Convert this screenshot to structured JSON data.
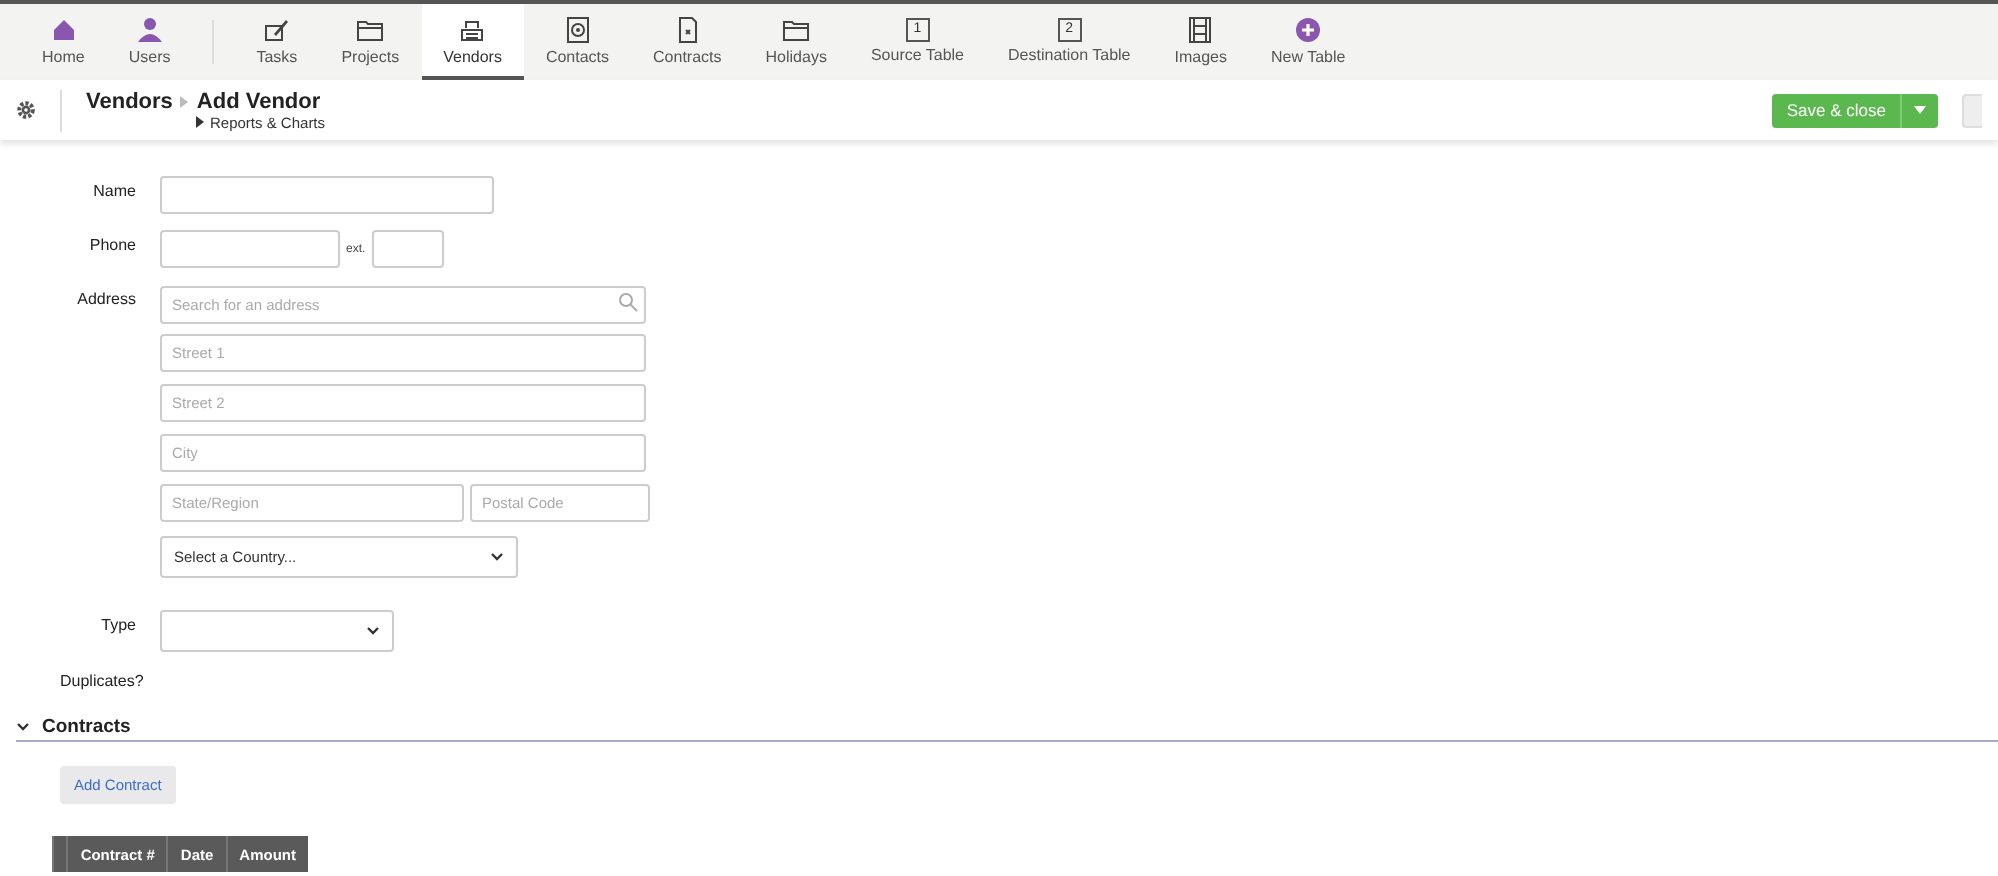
{
  "nav": {
    "items": [
      {
        "label": "Home",
        "kind": "home",
        "selected": false
      },
      {
        "label": "Users",
        "kind": "user",
        "selected": false
      },
      {
        "label": "Tasks",
        "kind": "tasks",
        "selected": false
      },
      {
        "label": "Projects",
        "kind": "folder",
        "selected": false
      },
      {
        "label": "Vendors",
        "kind": "vendor",
        "selected": true
      },
      {
        "label": "Contacts",
        "kind": "contact",
        "selected": false
      },
      {
        "label": "Contracts",
        "kind": "doc",
        "selected": false
      },
      {
        "label": "Holidays",
        "kind": "folder",
        "selected": false
      },
      {
        "label": "Source Table",
        "kind": "box",
        "glyph": "1",
        "selected": false
      },
      {
        "label": "Destination Table",
        "kind": "box",
        "glyph": "2",
        "selected": false
      },
      {
        "label": "Images",
        "kind": "film",
        "selected": false
      },
      {
        "label": "New Table",
        "kind": "plus",
        "selected": false
      }
    ]
  },
  "header": {
    "breadcrumb": "Vendors",
    "title": "Add Vendor",
    "sublink": "Reports & Charts",
    "save_button": "Save & close"
  },
  "form": {
    "name": {
      "label": "Name"
    },
    "phone": {
      "label": "Phone",
      "ext_label": "ext."
    },
    "address": {
      "label": "Address",
      "search_placeholder": "Search for an address",
      "street1_placeholder": "Street 1",
      "street2_placeholder": "Street 2",
      "city_placeholder": "City",
      "state_placeholder": "State/Region",
      "postal_placeholder": "Postal Code",
      "country_value": "Select a Country..."
    },
    "type": {
      "label": "Type"
    },
    "duplicates_label": "Duplicates?"
  },
  "contracts": {
    "title": "Contracts",
    "expanded": true,
    "add_button": "Add Contract",
    "columns": [
      "Contract #",
      "Date",
      "Amount"
    ]
  }
}
